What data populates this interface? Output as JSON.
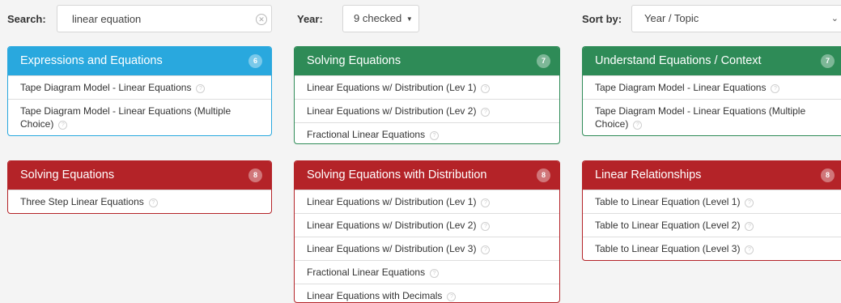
{
  "filters": {
    "search_label": "Search:",
    "search_value": "linear equation",
    "year_label": "Year:",
    "year_value": "9 checked",
    "sort_label": "Sort by:",
    "sort_value": "Year / Topic"
  },
  "colors": {
    "blue": "#29a8de",
    "green": "#2e8b57",
    "red": "#b42328"
  },
  "panels": [
    {
      "title": "Expressions and Equations",
      "count": "6",
      "color": "blue",
      "items": [
        "Tape Diagram Model - Linear Equations",
        "Tape Diagram Model - Linear Equations (Multiple Choice)"
      ]
    },
    {
      "title": "Solving Equations",
      "count": "7",
      "color": "green",
      "items": [
        "Linear Equations w/ Distribution (Lev 1)",
        "Linear Equations w/ Distribution (Lev 2)",
        "Fractional Linear Equations"
      ]
    },
    {
      "title": "Understand Equations / Context",
      "count": "7",
      "color": "green",
      "items": [
        "Tape Diagram Model - Linear Equations",
        "Tape Diagram Model - Linear Equations (Multiple Choice)"
      ]
    },
    {
      "title": "Solving Equations",
      "count": "8",
      "color": "red",
      "items": [
        "Three Step Linear Equations"
      ]
    },
    {
      "title": "Solving Equations with Distribution",
      "count": "8",
      "color": "red",
      "items": [
        "Linear Equations w/ Distribution (Lev 1)",
        "Linear Equations w/ Distribution (Lev 2)",
        "Linear Equations w/ Distribution (Lev 3)",
        "Fractional Linear Equations",
        "Linear Equations with Decimals"
      ]
    },
    {
      "title": "Linear Relationships",
      "count": "8",
      "color": "red",
      "items": [
        "Table to Linear Equation (Level 1)",
        "Table to Linear Equation (Level 2)",
        "Table to Linear Equation (Level 3)"
      ]
    }
  ]
}
